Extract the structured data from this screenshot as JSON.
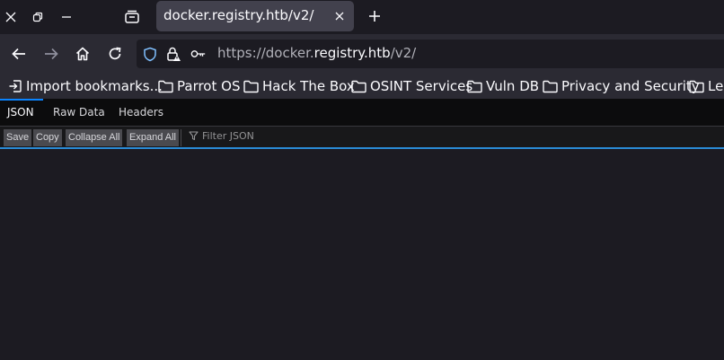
{
  "tab": {
    "title": "docker.registry.htb/v2/"
  },
  "url": {
    "pre": "https://docker.",
    "domain": "registry.htb",
    "path": "/v2/"
  },
  "bookmarks": [
    {
      "label": "Import bookmarks...",
      "icon": "import-icon"
    },
    {
      "label": "Parrot OS",
      "icon": "folder-icon"
    },
    {
      "label": "Hack The Box",
      "icon": "folder-icon"
    },
    {
      "label": "OSINT Services",
      "icon": "folder-icon"
    },
    {
      "label": "Vuln DB",
      "icon": "folder-icon"
    },
    {
      "label": "Privacy and Security",
      "icon": "folder-icon"
    },
    {
      "label": "Lea",
      "icon": "folder-icon"
    }
  ],
  "viewer": {
    "tabs": [
      "JSON",
      "Raw Data",
      "Headers"
    ],
    "active_tab": "JSON",
    "toolbar": {
      "save": "Save",
      "copy": "Copy",
      "collapse_all": "Collapse All",
      "expand_all": "Expand All",
      "filter_placeholder": "Filter JSON"
    }
  },
  "colors": {
    "accent": "#0a84ff",
    "toolbar_border": "#2a8bd6",
    "tab_active": "#42414d"
  }
}
